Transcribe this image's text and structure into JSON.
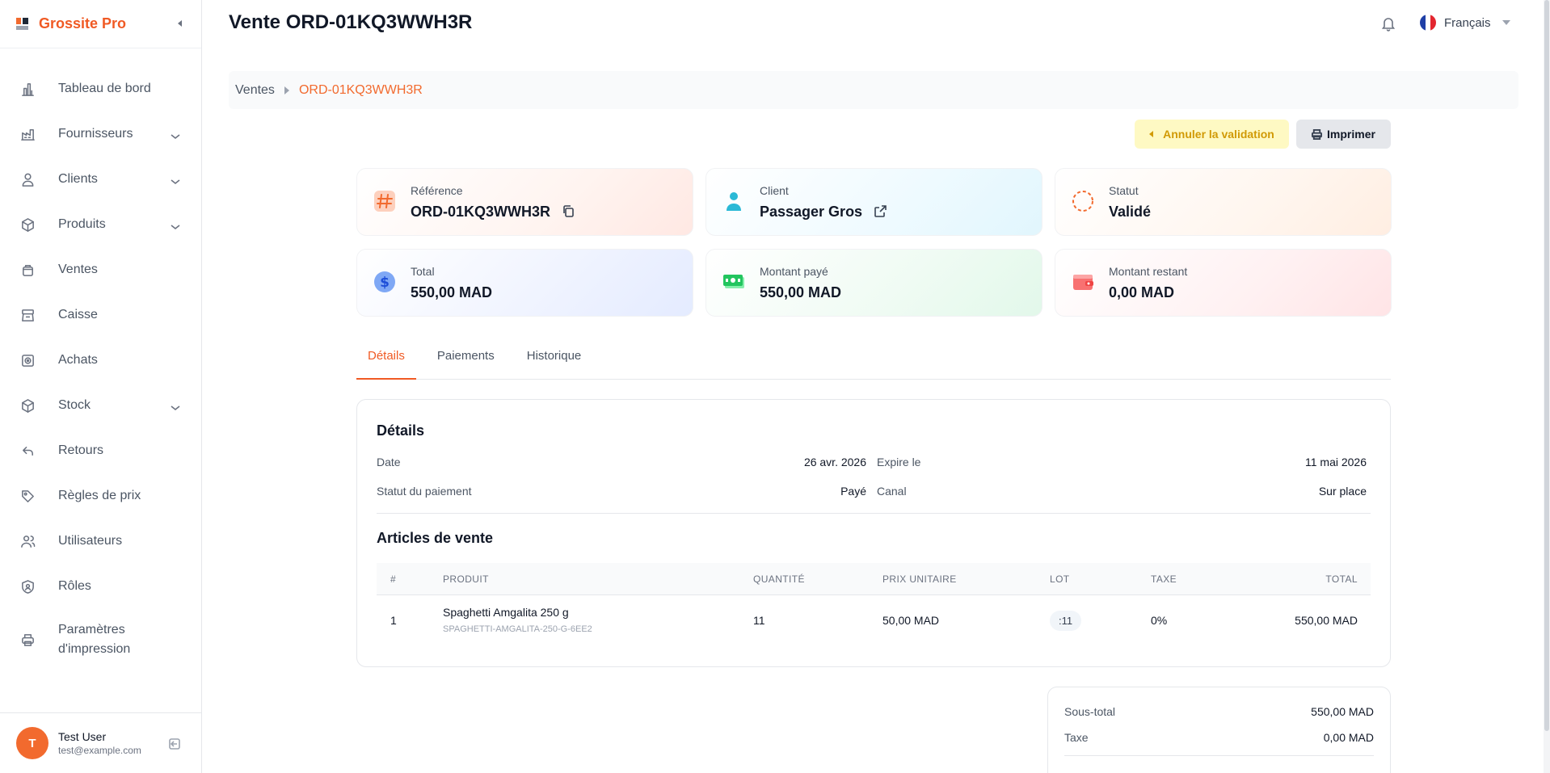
{
  "app": {
    "name": "Grossite Pro"
  },
  "sidebar": {
    "items": [
      {
        "label": "Tableau de bord",
        "icon": "chart-bar-icon"
      },
      {
        "label": "Fournisseurs",
        "icon": "factory-icon"
      },
      {
        "label": "Clients",
        "icon": "user-icon"
      },
      {
        "label": "Produits",
        "icon": "cube-icon"
      },
      {
        "label": "Ventes",
        "icon": "basket-icon"
      },
      {
        "label": "Caisse",
        "icon": "cash-register-icon"
      },
      {
        "label": "Achats",
        "icon": "vault-icon"
      },
      {
        "label": "Stock",
        "icon": "box-icon"
      },
      {
        "label": "Retours",
        "icon": "return-arrow-icon"
      },
      {
        "label": "Règles de prix",
        "icon": "tag-icon"
      },
      {
        "label": "Utilisateurs",
        "icon": "users-icon"
      },
      {
        "label": "Rôles",
        "icon": "shield-icon"
      },
      {
        "label": "Paramètres d'impression",
        "icon": "printer-icon"
      }
    ],
    "user": {
      "initial": "T",
      "name": "Test User",
      "email": "test@example.com"
    }
  },
  "header": {
    "title": "Vente ORD-01KQ3WWH3R",
    "language": "Français"
  },
  "breadcrumb": {
    "parent": "Ventes",
    "current": "ORD-01KQ3WWH3R"
  },
  "actions": {
    "cancel_label": "Annuler la validation",
    "print_label": "Imprimer"
  },
  "cards": {
    "reference": {
      "label": "Référence",
      "value": "ORD-01KQ3WWH3R"
    },
    "client": {
      "label": "Client",
      "value": "Passager Gros"
    },
    "status": {
      "label": "Statut",
      "value": "Validé"
    },
    "total": {
      "label": "Total",
      "value": "550,00 MAD"
    },
    "paid": {
      "label": "Montant payé",
      "value": "550,00 MAD"
    },
    "remaining": {
      "label": "Montant restant",
      "value": "0,00 MAD"
    }
  },
  "tabs": [
    "Détails",
    "Paiements",
    "Historique"
  ],
  "details": {
    "title": "Détails",
    "date": {
      "label": "Date",
      "value": "26 avr. 2026"
    },
    "expires": {
      "label": "Expire le",
      "value": "11 mai 2026"
    },
    "payment_status": {
      "label": "Statut du paiement",
      "value": "Payé"
    },
    "channel": {
      "label": "Canal",
      "value": "Sur place"
    }
  },
  "items": {
    "title": "Articles de vente",
    "columns": [
      "#",
      "PRODUIT",
      "QUANTITÉ",
      "PRIX UNITAIRE",
      "LOT",
      "TAXE",
      "TOTAL"
    ],
    "rows": [
      {
        "num": "1",
        "product": "Spaghetti Amgalita 250 g",
        "sku": "SPAGHETTI-AMGALITA-250-G-6EE2",
        "qty": "11",
        "unit_price": "50,00 MAD",
        "lot": ":11",
        "tax": "0%",
        "total": "550,00 MAD"
      }
    ]
  },
  "summary": {
    "subtotal": {
      "label": "Sous-total",
      "value": "550,00 MAD"
    },
    "tax": {
      "label": "Taxe",
      "value": "0,00 MAD"
    }
  }
}
